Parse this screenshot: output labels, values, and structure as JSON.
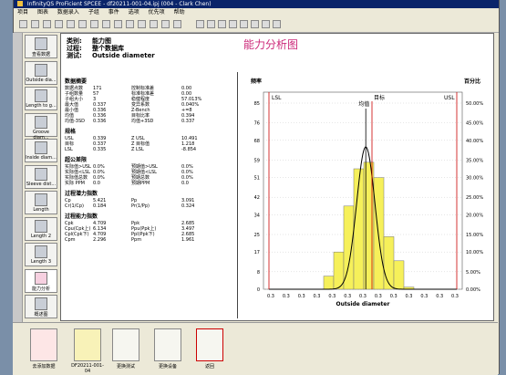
{
  "window": {
    "title": "InfinityQS ProFicient SPCEE - df20211-001-04.ipj (004 - Clark Chen)"
  },
  "menu": [
    "项目",
    "图表",
    "数据录入",
    "子组",
    "事件",
    "选项",
    "优先项",
    "帮助"
  ],
  "nav": [
    "查看数据",
    "Outside dia...",
    "Length to g...",
    "Groove diam...",
    "Inside diam...",
    "Sleeve dist...",
    "Length",
    "Length 2",
    "Length 3",
    "能力分析",
    "概述图"
  ],
  "header": {
    "category_label": "类别:",
    "category_value": "能力图",
    "process_label": "过程:",
    "process_value": "整个数据库",
    "test_label": "测试:",
    "test_value": "Outside diameter",
    "title": "能力分析图"
  },
  "stats": {
    "summary_title": "数据摘要",
    "summary": [
      [
        "数据点数",
        "171",
        "控制标准差",
        "0.00"
      ],
      [
        "子组数量",
        "57",
        "标准标准差",
        "0.00"
      ],
      [
        "子组大小",
        "3",
        "稳健程度",
        "57.013%"
      ],
      [
        "最大值",
        "0.337",
        "变异系数",
        "0.040%"
      ],
      [
        "最小值",
        "0.336",
        "Z-Bench",
        "+=8"
      ],
      [
        "均值",
        "0.336",
        "目标比率",
        "0.394"
      ],
      [
        "均值-3SD",
        "0.336",
        "均值+3SD",
        "0.337"
      ]
    ],
    "spec_title": "规格",
    "spec": [
      [
        "USL",
        "0.339",
        "Z USL",
        "10.491"
      ],
      [
        "目标",
        "0.337",
        "Z 目标值",
        "1.218"
      ],
      [
        "LSL",
        "0.335",
        "Z LSL",
        "-8.854"
      ]
    ],
    "oos_title": "超公差限",
    "oos": [
      [
        "实际值>USL",
        "0.0%",
        "预期值>USL",
        "0.0%"
      ],
      [
        "实际值<LSL",
        "0.0%",
        "预期值<LSL",
        "0.0%"
      ],
      [
        "实际值总数",
        "0.0%",
        "预期总数",
        "0.0%"
      ],
      [
        "实际 PPM",
        "0.0",
        "预期PPM",
        "0.0"
      ]
    ],
    "cap_title": "过程潜力指数",
    "cap": [
      [
        "Cp",
        "5.421",
        "Pp",
        "3.091"
      ],
      [
        "Cr(1/Cp)",
        "0.184",
        "Pr(1/Pp)",
        "0.324"
      ]
    ],
    "perf_title": "过程能力指数",
    "perf": [
      [
        "Cpk",
        "4.709",
        "Ppk",
        "2.685"
      ],
      [
        "Cpu(Cpk上)",
        "6.134",
        "Ppu(Ppk上)",
        "3.497"
      ],
      [
        "Cpl(Cpk下)",
        "4.709",
        "Ppl(Ppk下)",
        "2.685"
      ],
      [
        "Cpm",
        "2.296",
        "Ppm",
        "1.961"
      ]
    ]
  },
  "chart_data": {
    "type": "bar",
    "ylabel_left": "频率",
    "ylabel_right": "百分比",
    "xlabel": "Outside diameter",
    "y_ticks": [
      0,
      8,
      17,
      25,
      34,
      42,
      51,
      59,
      68,
      76,
      85
    ],
    "right_ticks": [
      "0.00%",
      "5.00%",
      "10.00%",
      "15.00%",
      "20.00%",
      "25.00%",
      "30.00%",
      "35.00%",
      "40.00%",
      "45.00%",
      "50.00%"
    ],
    "x_tick_label": "0.3",
    "x_tick_count": 13,
    "ylim": [
      0,
      90
    ],
    "bars": [
      6,
      17,
      38,
      55,
      58,
      51,
      24,
      13,
      1
    ],
    "spec_labels": {
      "lsl": "LSL",
      "usl": "USL",
      "target": "目标",
      "mean": "均值"
    }
  },
  "bottom": {
    "buttons": [
      "去添加数据",
      "DF20211-001-04",
      "更换测试",
      "更换设备",
      "返回"
    ]
  }
}
